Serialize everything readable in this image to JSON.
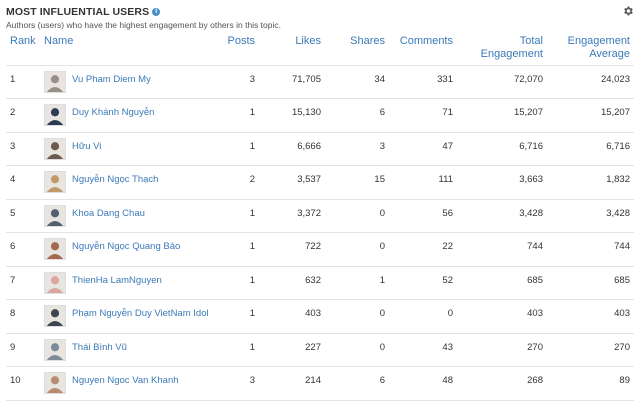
{
  "header": {
    "title": "MOST INFLUENTIAL USERS",
    "info_icon": "i",
    "subtitle": "Authors (users) who have the highest engagement by others in this topic."
  },
  "columns": {
    "rank": "Rank",
    "name": "Name",
    "posts": "Posts",
    "likes": "Likes",
    "shares": "Shares",
    "comments": "Comments",
    "total": "Total Engagement",
    "average": "Engagement Average"
  },
  "colors": {
    "link": "#3b7ab8",
    "border": "#e3e3e3",
    "info": "#4a90c8"
  },
  "rows": [
    {
      "rank": "1",
      "name": "Vu Pham Diem My",
      "posts": "3",
      "likes": "71,705",
      "shares": "34",
      "comments": "331",
      "total": "72,070",
      "average": "24,023",
      "avatar": "#9a8f86"
    },
    {
      "rank": "2",
      "name": "Duy Khánh Nguyễn",
      "posts": "1",
      "likes": "15,130",
      "shares": "6",
      "comments": "71",
      "total": "15,207",
      "average": "15,207",
      "avatar": "#2d3a55"
    },
    {
      "rank": "3",
      "name": "Hữu Vi",
      "posts": "1",
      "likes": "6,666",
      "shares": "3",
      "comments": "47",
      "total": "6,716",
      "average": "6,716",
      "avatar": "#6b5a50"
    },
    {
      "rank": "4",
      "name": "Nguyễn Ngọc Thạch",
      "posts": "2",
      "likes": "3,537",
      "shares": "15",
      "comments": "111",
      "total": "3,663",
      "average": "1,832",
      "avatar": "#c29a6a"
    },
    {
      "rank": "5",
      "name": "Khoa Dang Chau",
      "posts": "1",
      "likes": "3,372",
      "shares": "0",
      "comments": "56",
      "total": "3,428",
      "average": "3,428",
      "avatar": "#55606e"
    },
    {
      "rank": "6",
      "name": "Nguyễn Ngọc Quang Bảo",
      "posts": "1",
      "likes": "722",
      "shares": "0",
      "comments": "22",
      "total": "744",
      "average": "744",
      "avatar": "#a36a4e"
    },
    {
      "rank": "7",
      "name": "ThienHa LamNguyen",
      "posts": "1",
      "likes": "632",
      "shares": "1",
      "comments": "52",
      "total": "685",
      "average": "685",
      "avatar": "#d9a7a0"
    },
    {
      "rank": "8",
      "name": "Phạm Nguyễn Duy VietNam Idol",
      "posts": "1",
      "likes": "403",
      "shares": "0",
      "comments": "0",
      "total": "403",
      "average": "403",
      "avatar": "#3e4450"
    },
    {
      "rank": "9",
      "name": "Thái Bình Vũ",
      "posts": "1",
      "likes": "227",
      "shares": "0",
      "comments": "43",
      "total": "270",
      "average": "270",
      "avatar": "#7b8c98"
    },
    {
      "rank": "10",
      "name": "Nguyen Ngoc Van Khanh",
      "posts": "3",
      "likes": "214",
      "shares": "6",
      "comments": "48",
      "total": "268",
      "average": "89",
      "avatar": "#b88b72"
    }
  ]
}
